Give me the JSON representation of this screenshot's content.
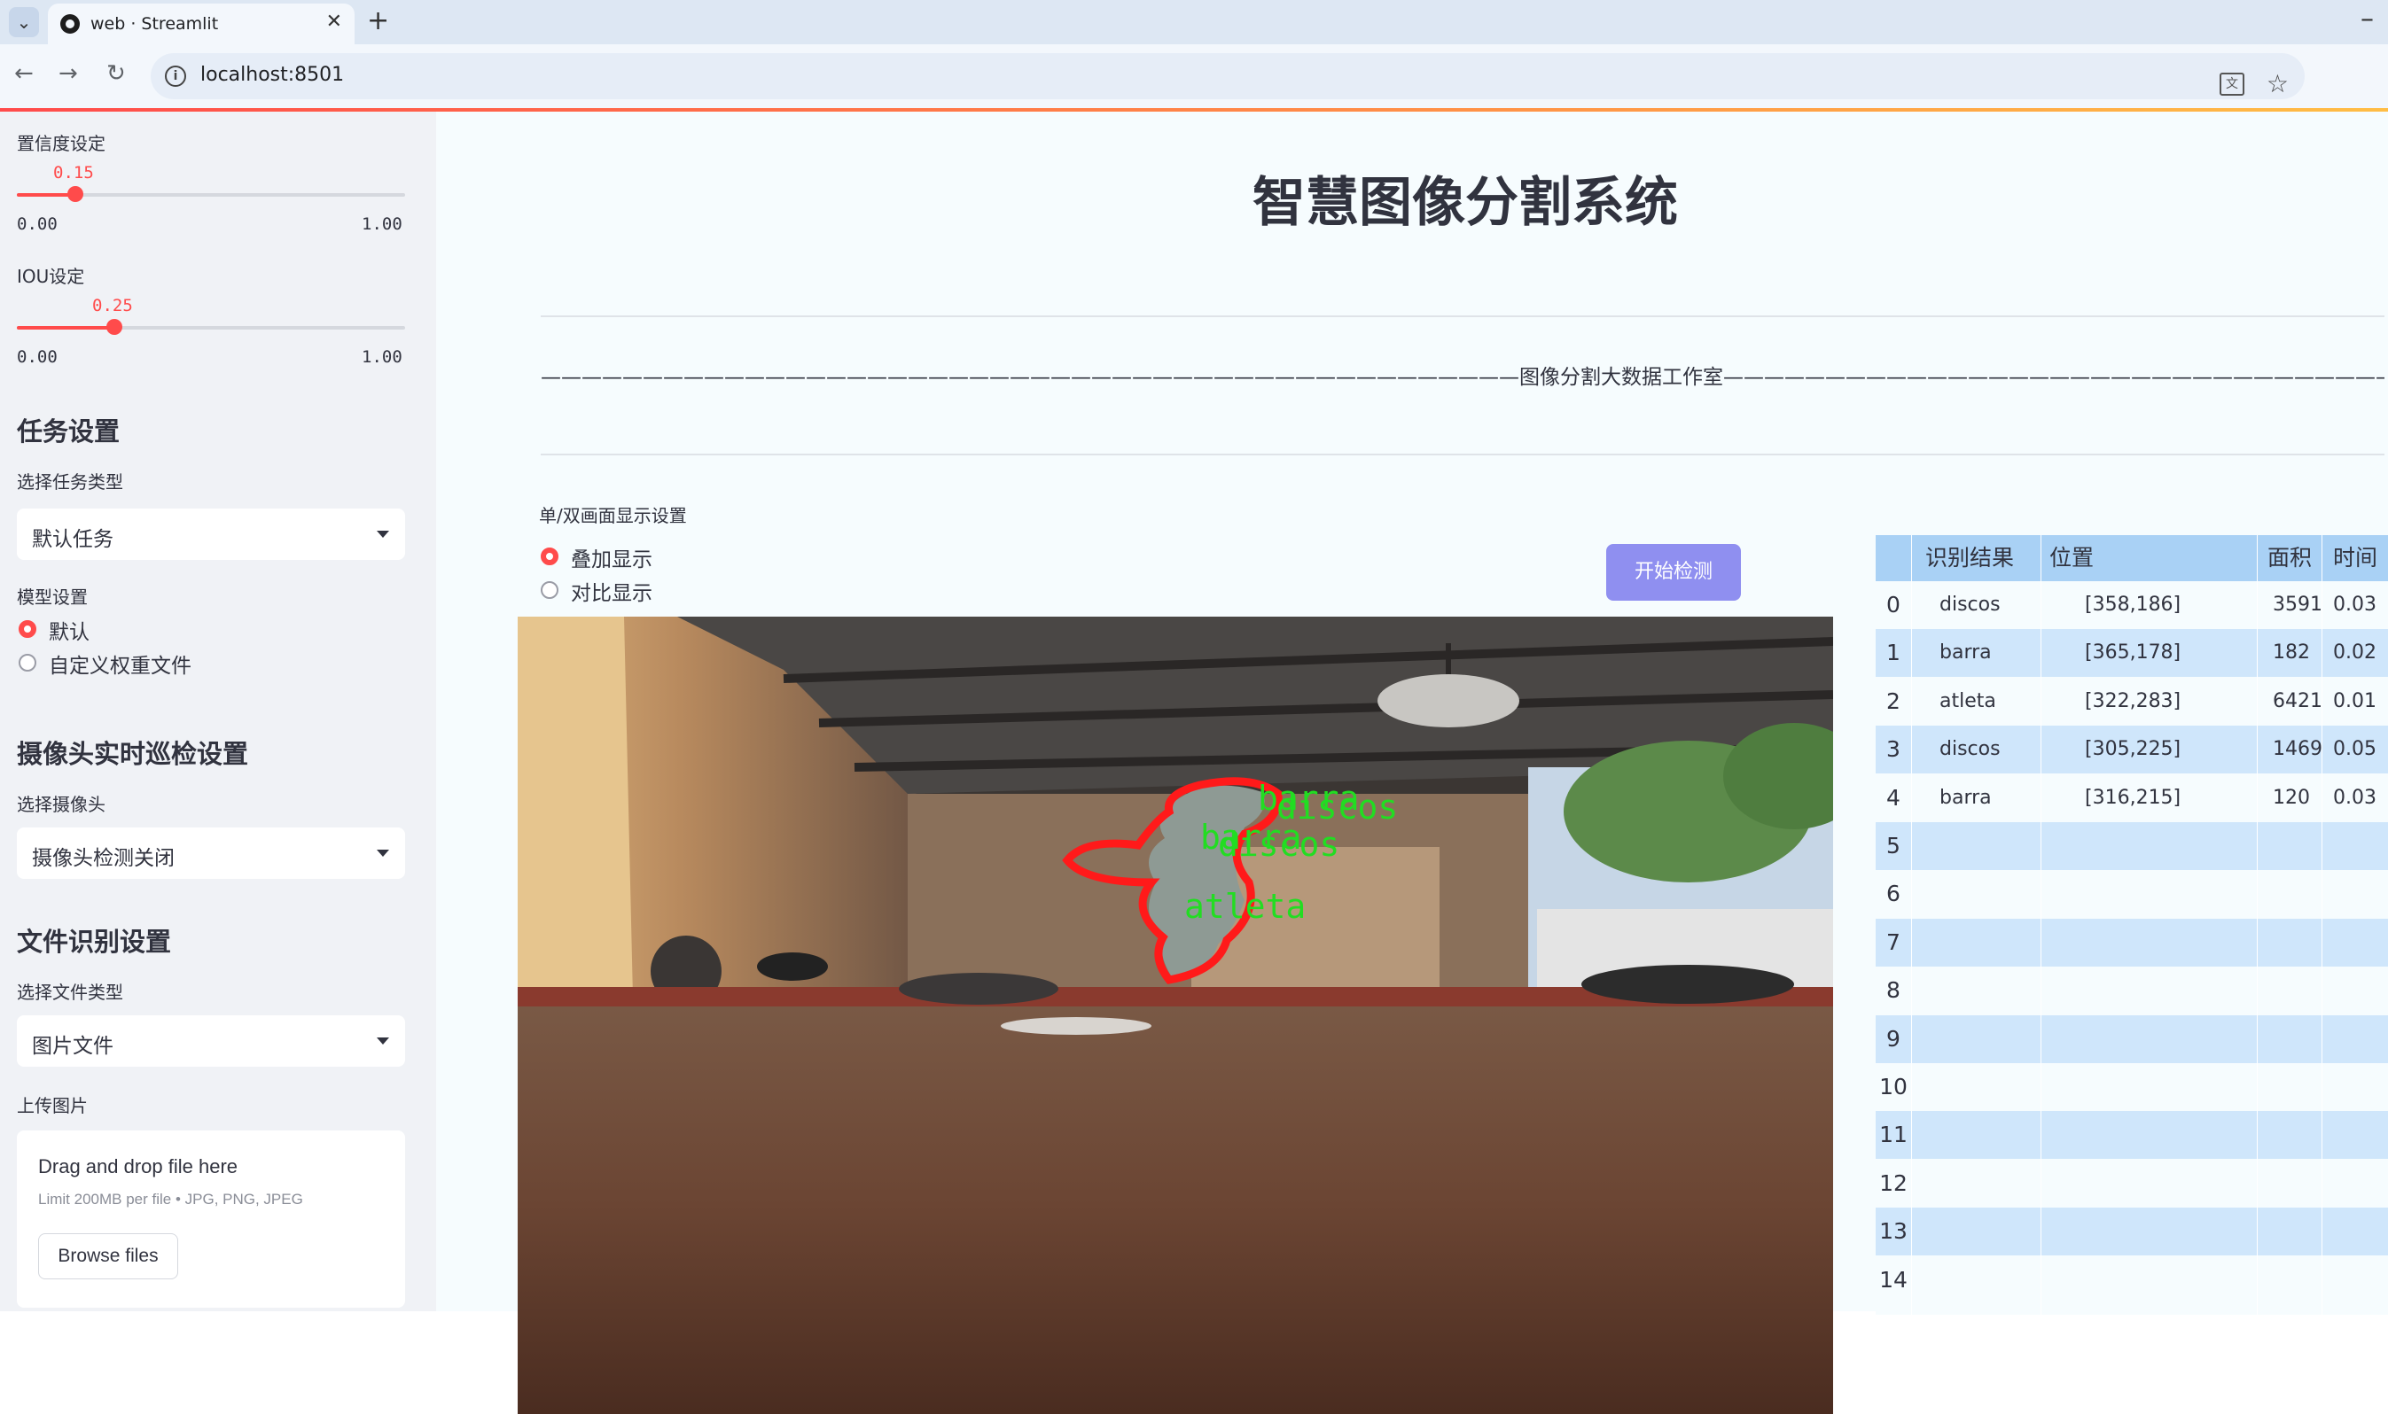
{
  "browser": {
    "tab_title": "web · Streamlit",
    "url": "localhost:8501"
  },
  "sidebar": {
    "confidence": {
      "label": "置信度设定",
      "value": "0.15",
      "min": "0.00",
      "max": "1.00",
      "fraction": 0.15
    },
    "iou": {
      "label": "IOU设定",
      "value": "0.25",
      "min": "0.00",
      "max": "1.00",
      "fraction": 0.25
    },
    "task_section": {
      "heading": "任务设置",
      "task_type_label": "选择任务类型",
      "task_type_value": "默认任务",
      "model_label": "模型设置",
      "model_options": [
        "默认",
        "自定义权重文件"
      ],
      "model_selected": 0
    },
    "camera_section": {
      "heading": "摄像头实时巡检设置",
      "camera_label": "选择摄像头",
      "camera_value": "摄像头检测关闭"
    },
    "file_section": {
      "heading": "文件识别设置",
      "file_type_label": "选择文件类型",
      "file_type_value": "图片文件",
      "upload_label": "上传图片",
      "drop_text": "Drag and drop file here",
      "limit_text": "Limit 200MB per file • JPG, PNG, JPEG",
      "browse_label": "Browse files"
    }
  },
  "main": {
    "title": "智慧图像分割系统",
    "subtitle_line": "————————————————————————————————————————————————图像分割大数据工作室————————————————————————————————————————————————",
    "display_label": "单/双画面显示设置",
    "display_options": [
      "叠加显示",
      "对比显示"
    ],
    "display_selected": 0,
    "detect_button": "开始检测",
    "detections": [
      {
        "label": "barra",
        "color": "#22dd22"
      },
      {
        "label": "discos",
        "color": "#22dd22"
      },
      {
        "label": "barra",
        "color": "#22dd22"
      },
      {
        "label": "discos",
        "color": "#22dd22"
      },
      {
        "label": "atleta",
        "color": "#22dd22"
      }
    ]
  },
  "table": {
    "columns": [
      "识别结果",
      "位置",
      "面积",
      "时间"
    ],
    "rows": [
      {
        "index": "0",
        "result": "discos",
        "position": "[358,186]",
        "area": "3591",
        "time": "0.03"
      },
      {
        "index": "1",
        "result": "barra",
        "position": "[365,178]",
        "area": "182",
        "time": "0.02"
      },
      {
        "index": "2",
        "result": "atleta",
        "position": "[322,283]",
        "area": "6421",
        "time": "0.01"
      },
      {
        "index": "3",
        "result": "discos",
        "position": "[305,225]",
        "area": "1469",
        "time": "0.05"
      },
      {
        "index": "4",
        "result": "barra",
        "position": "[316,215]",
        "area": "120",
        "time": "0.03"
      },
      {
        "index": "5",
        "result": "",
        "position": "",
        "area": "",
        "time": ""
      },
      {
        "index": "6",
        "result": "",
        "position": "",
        "area": "",
        "time": ""
      },
      {
        "index": "7",
        "result": "",
        "position": "",
        "area": "",
        "time": ""
      },
      {
        "index": "8",
        "result": "",
        "position": "",
        "area": "",
        "time": ""
      },
      {
        "index": "9",
        "result": "",
        "position": "",
        "area": "",
        "time": ""
      },
      {
        "index": "10",
        "result": "",
        "position": "",
        "area": "",
        "time": ""
      },
      {
        "index": "11",
        "result": "",
        "position": "",
        "area": "",
        "time": ""
      },
      {
        "index": "12",
        "result": "",
        "position": "",
        "area": "",
        "time": ""
      },
      {
        "index": "13",
        "result": "",
        "position": "",
        "area": "",
        "time": ""
      },
      {
        "index": "14",
        "result": "",
        "position": "",
        "area": "",
        "time": ""
      }
    ]
  }
}
